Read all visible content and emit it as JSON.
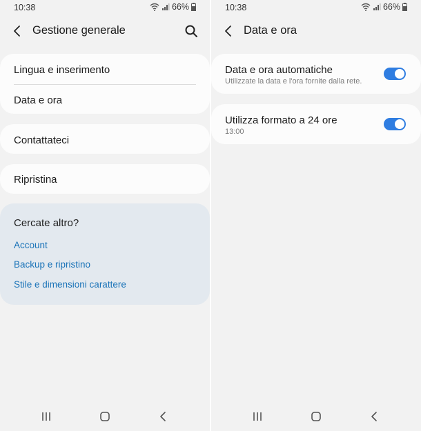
{
  "left_screen": {
    "status": {
      "time": "10:38",
      "battery": "66%"
    },
    "header": {
      "title": "Gestione generale"
    },
    "group1": {
      "items": [
        "Lingua e inserimento",
        "Data e ora"
      ]
    },
    "contact": {
      "label": "Contattateci"
    },
    "reset": {
      "label": "Ripristina"
    },
    "suggestions": {
      "title": "Cercate altro?",
      "links": [
        "Account",
        "Backup e ripristino",
        "Stile e dimensioni carattere"
      ]
    }
  },
  "right_screen": {
    "status": {
      "time": "10:38",
      "battery": "66%"
    },
    "header": {
      "title": "Data e ora"
    },
    "auto_datetime": {
      "title": "Data e ora automatiche",
      "subtitle": "Utilizzate la data e l'ora fornite dalla rete.",
      "enabled": true
    },
    "format24": {
      "title": "Utilizza formato a 24 ore",
      "subtitle": "13:00",
      "enabled": true
    }
  },
  "colors": {
    "accent": "#2f7de1",
    "link": "#1a73b8",
    "suggestion_bg": "#e3e9ef",
    "card_bg": "#fcfcfc",
    "page_bg": "#f2f2f2"
  },
  "icons": [
    "back-icon",
    "search-icon",
    "wifi-icon",
    "signal-icon",
    "battery-icon",
    "recents-icon",
    "home-icon",
    "nav-back-icon"
  ]
}
